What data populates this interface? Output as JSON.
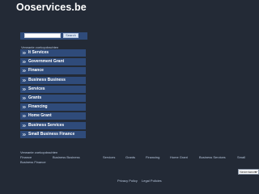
{
  "site": {
    "title": "Ooservices.be"
  },
  "search": {
    "placeholder": "",
    "value": "",
    "button_label": "Search"
  },
  "related_searches": {
    "heading": "Verwante zoekopdrachten",
    "items": [
      {
        "label": "It Services"
      },
      {
        "label": "Government Grant"
      },
      {
        "label": "Finance"
      },
      {
        "label": "Business Business"
      },
      {
        "label": "Services"
      },
      {
        "label": "Grants"
      },
      {
        "label": "Financing"
      },
      {
        "label": "Home Grant"
      },
      {
        "label": "Business Services"
      },
      {
        "label": "Small Business Finance"
      }
    ]
  },
  "footer": {
    "heading": "Verwante zoekopdrachten",
    "links": [
      {
        "label": "Finance"
      },
      {
        "label": "Business Business"
      },
      {
        "label": "Services"
      },
      {
        "label": "Grants"
      },
      {
        "label": "Financing"
      },
      {
        "label": "Home Grant"
      },
      {
        "label": "Business Services"
      },
      {
        "label": "Small"
      },
      {
        "label": "Business Finance"
      }
    ]
  },
  "language": {
    "selected": "Nederlands"
  },
  "legal": {
    "privacy_label": "Privacy Policy",
    "terms_label": "Legal Policies"
  },
  "colors": {
    "background": "#232a36",
    "panel": "#2f4b7a",
    "text_light": "#b8c7dd",
    "accent_arrow": "#e8eef7"
  }
}
